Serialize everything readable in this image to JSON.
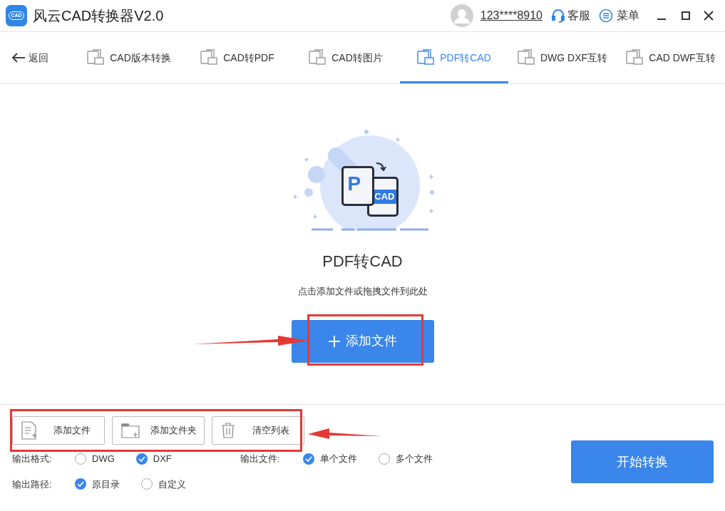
{
  "window": {
    "title": "风云CAD转换器V2.0",
    "logo_text": "CAD",
    "user": "123****8910",
    "service": "客服",
    "menu": "菜单"
  },
  "back": "返回",
  "tabs": [
    {
      "label": "CAD版本转换",
      "selected": false
    },
    {
      "label": "CAD转PDF",
      "selected": false
    },
    {
      "label": "CAD转图片",
      "selected": false
    },
    {
      "label": "PDF转CAD",
      "selected": true
    },
    {
      "label": "DWG DXF互转",
      "selected": false
    },
    {
      "label": "CAD DWF互转",
      "selected": false
    }
  ],
  "illustration": {
    "left_letter": "P",
    "right_label": "CAD"
  },
  "heading": "PDF转CAD",
  "hint": "点击添加文件或拖拽文件到此处",
  "add_button": "添加文件",
  "toolbar": [
    {
      "kind": "file",
      "label": "添加文件"
    },
    {
      "kind": "folder",
      "label": "添加文件夹"
    },
    {
      "kind": "trash",
      "label": "清空列表"
    }
  ],
  "options": [
    {
      "label": "输出格式:",
      "choices": [
        {
          "label": "DWG",
          "selected": false
        },
        {
          "label": "DXF",
          "selected": true
        }
      ]
    },
    {
      "label": "输出文件:",
      "choices": [
        {
          "label": "单个文件",
          "selected": true
        },
        {
          "label": "多个文件",
          "selected": false
        }
      ]
    },
    {
      "label": "输出路径:",
      "choices": [
        {
          "label": "原目录",
          "selected": true
        },
        {
          "label": "自定义",
          "selected": false
        }
      ]
    }
  ],
  "start_button": "开始转换"
}
